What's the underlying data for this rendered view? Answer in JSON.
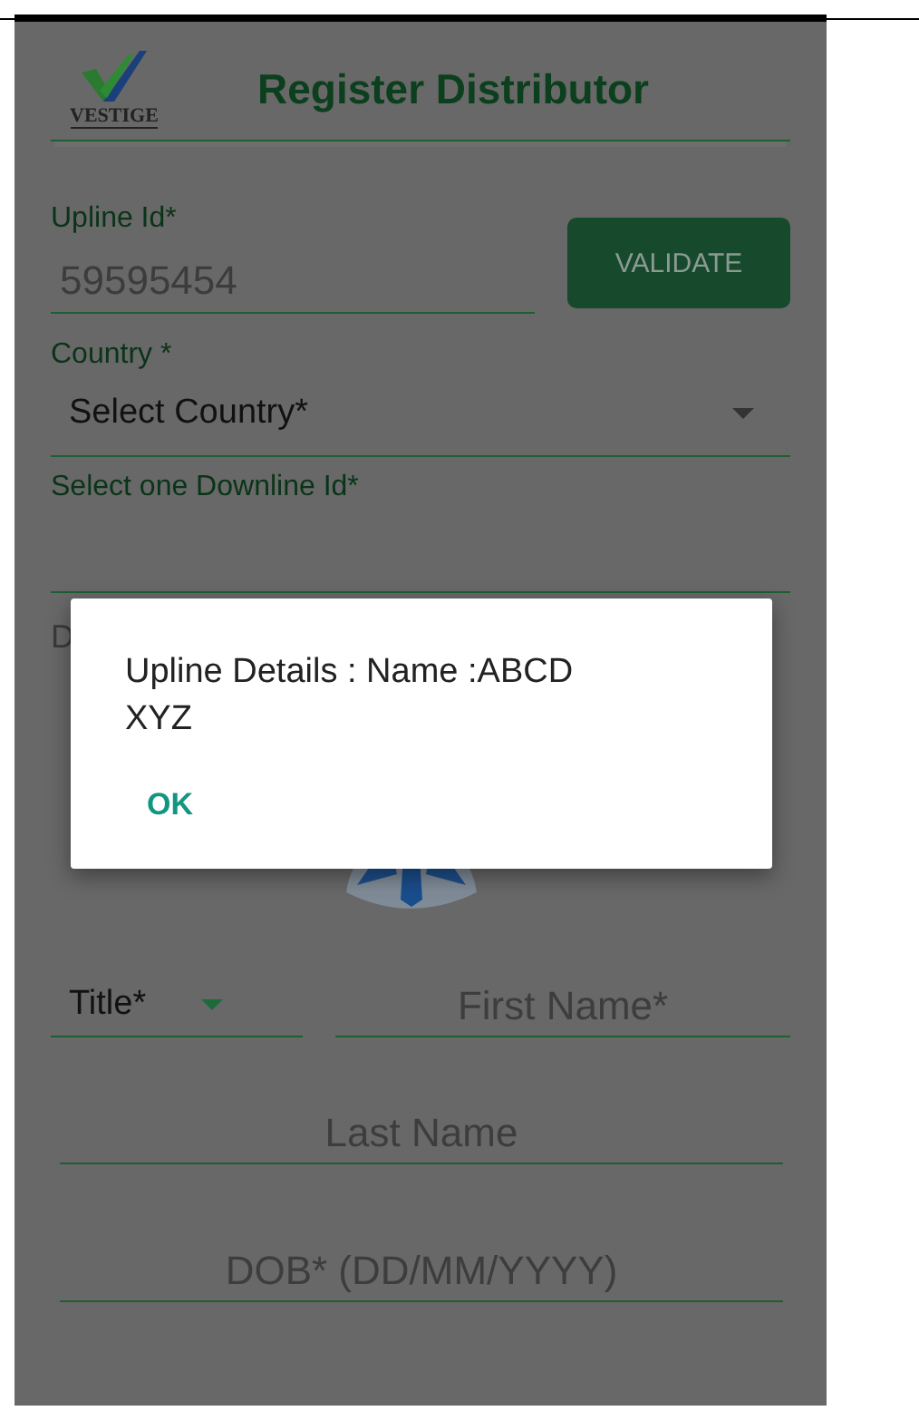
{
  "header": {
    "brand": "VESTIGE",
    "title": "Register Distributor"
  },
  "upline": {
    "label": "Upline Id*",
    "value": "59595454",
    "button": "VALIDATE"
  },
  "country": {
    "label": "Country *",
    "value": "Select Country*"
  },
  "downline": {
    "label": "Select one Downline Id*"
  },
  "covered_label": "D",
  "title_select": {
    "value": "Title*"
  },
  "first_name": {
    "placeholder": "First Name*"
  },
  "last_name": {
    "placeholder": "Last Name"
  },
  "dob": {
    "placeholder": "DOB* (DD/MM/YYYY)"
  },
  "dialog": {
    "message": "Upline Details : Name :ABCD XYZ",
    "button": "OK"
  }
}
